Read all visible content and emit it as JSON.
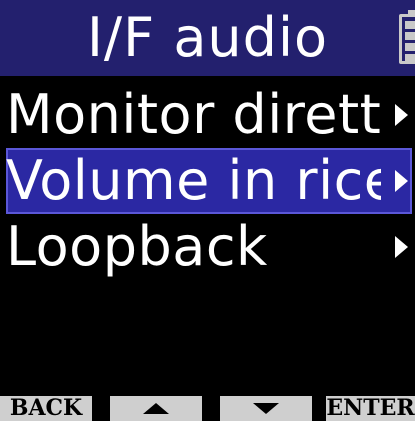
{
  "header": {
    "title": "I/F audio",
    "status_icon": "battery-icon"
  },
  "menu": {
    "items": [
      {
        "label": "Monitor diretto",
        "selected": false,
        "has_submenu": true
      },
      {
        "label": "Volume in ricezione",
        "selected": true,
        "has_submenu": true
      },
      {
        "label": "Loopback",
        "selected": false,
        "has_submenu": true
      }
    ]
  },
  "footer": {
    "back_label": "BACK",
    "up_icon": "triangle-up-icon",
    "down_icon": "triangle-down-icon",
    "enter_label": "ENTER"
  },
  "colors": {
    "header_bg": "#23206e",
    "selected_bg": "#2b28a3",
    "background": "#000000",
    "footer_bg": "#cfcfcf"
  }
}
